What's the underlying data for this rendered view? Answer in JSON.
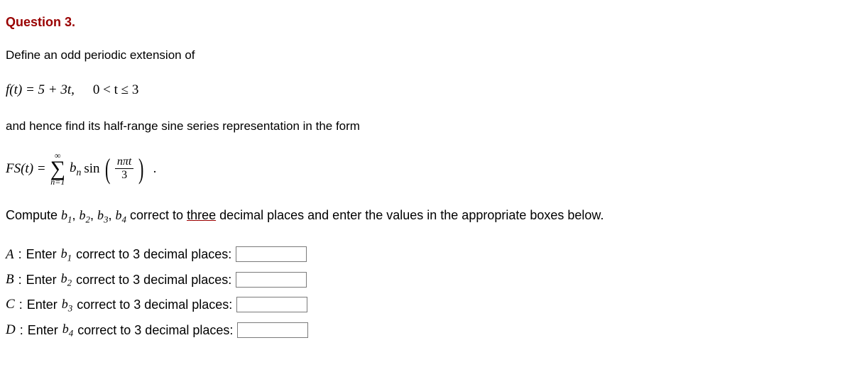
{
  "question_title": "Question 3.",
  "intro": "Define an odd periodic extension of",
  "func_def": "f(t) = 5 + 3t,",
  "domain_cond": "0 < t ≤ 3",
  "hence_line": "and hence find its half-range sine series representation in the form",
  "formula": {
    "lhs": "FS(t) =",
    "sigma_top": "∞",
    "sigma_sym": "∑",
    "sigma_bot": "n=1",
    "bn": "b",
    "bn_sub": "n",
    "sin": "sin",
    "frac_num": "nπt",
    "frac_den": "3",
    "period_dot": "."
  },
  "compute_pre": "Compute ",
  "b1": "b",
  "b1s": "1",
  "b2": "b",
  "b2s": "2",
  "b3": "b",
  "b3s": "3",
  "b4": "b",
  "b4s": "4",
  "compute_mid": " correct to ",
  "three_word": "three",
  "compute_post": " decimal places and enter the values in the appropriate boxes below.",
  "prompts": {
    "A_lbl": "A",
    "B_lbl": "B",
    "C_lbl": "C",
    "D_lbl": "D",
    "colon": ": ",
    "enter": "Enter ",
    "tail": " correct to 3 decimal places:"
  }
}
